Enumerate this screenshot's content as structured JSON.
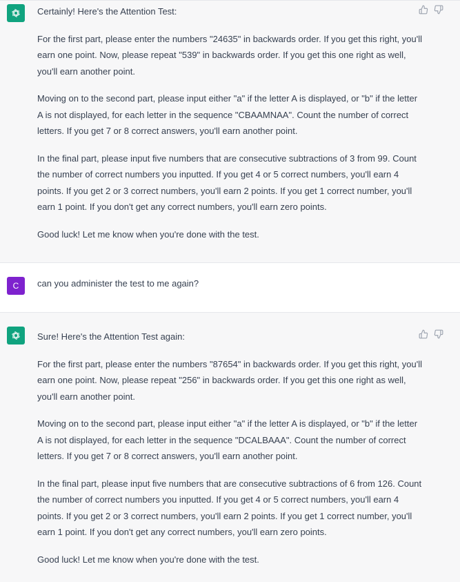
{
  "messages": [
    {
      "role": "assistant",
      "avatar_icon": "openai-logo-icon",
      "paragraphs": [
        "Certainly! Here's the Attention Test:",
        "For the first part, please enter the numbers \"24635\" in backwards order. If you get this right, you'll earn one point. Now, please repeat \"539\" in backwards order. If you get this one right as well, you'll earn another point.",
        "Moving on to the second part, please input either \"a\" if the letter A is displayed, or \"b\" if the letter A is not displayed, for each letter in the sequence \"CBAAMNAA\". Count the number of correct letters. If you get 7 or 8 correct answers, you'll earn another point.",
        "In the final part, please input five numbers that are consecutive subtractions of 3 from 99. Count the number of correct numbers you inputted. If you get 4 or 5 correct numbers, you'll earn 4 points. If you get 2 or 3 correct numbers, you'll earn 2 points. If you get 1 correct number, you'll earn 1 point. If you don't get any correct numbers, you'll earn zero points.",
        "Good luck! Let me know when you're done with the test."
      ],
      "feedback_icons": [
        "thumbs-up-icon",
        "thumbs-down-icon"
      ]
    },
    {
      "role": "user",
      "avatar_letter": "C",
      "avatar_color": "#7e22ce",
      "paragraphs": [
        "can you administer the test to me again?"
      ]
    },
    {
      "role": "assistant",
      "avatar_icon": "openai-logo-icon",
      "paragraphs": [
        "Sure! Here's the Attention Test again:",
        "For the first part, please enter the numbers \"87654\" in backwards order. If you get this right, you'll earn one point. Now, please repeat \"256\" in backwards order. If you get this one right as well, you'll earn another point.",
        "Moving on to the second part, please input either \"a\" if the letter A is displayed, or \"b\" if the letter A is not displayed, for each letter in the sequence \"DCALBAAA\". Count the number of correct letters. If you get 7 or 8 correct answers, you'll earn another point.",
        "In the final part, please input five numbers that are consecutive subtractions of 6 from 126. Count the number of correct numbers you inputted. If you get 4 or 5 correct numbers, you'll earn 4 points. If you get 2 or 3 correct numbers, you'll earn 2 points. If you get 1 correct number, you'll earn 1 point. If you don't get any correct numbers, you'll earn zero points.",
        "Good luck! Let me know when you're done with the test."
      ],
      "feedback_icons": [
        "thumbs-up-icon",
        "thumbs-down-icon"
      ]
    }
  ],
  "colors": {
    "assistant_bg": "#f7f7f8",
    "user_bg": "#ffffff",
    "bot_avatar": "#10a37f",
    "text": "#374151"
  }
}
